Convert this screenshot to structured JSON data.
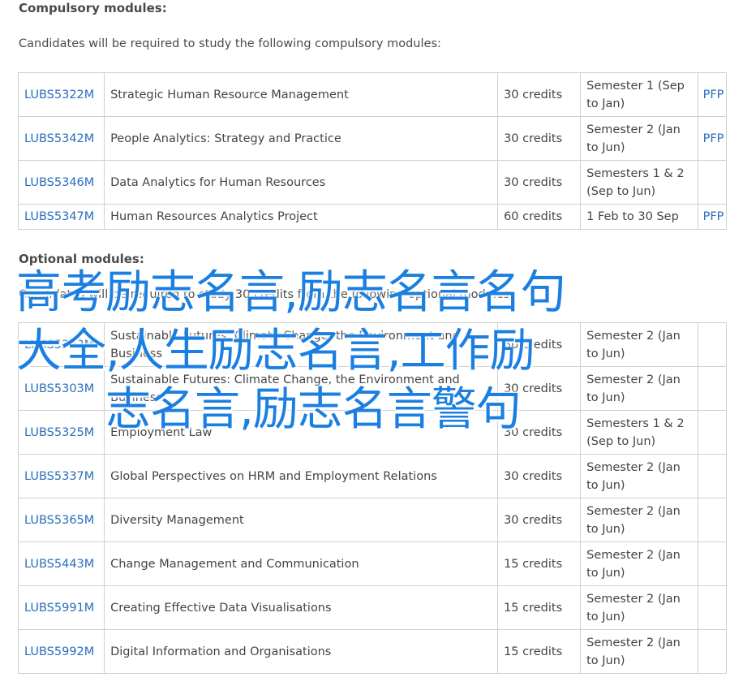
{
  "compulsory": {
    "heading": "Compulsory modules:",
    "intro": "Candidates will be required to study the following compulsory modules:",
    "rows": [
      {
        "code": "LUBS5322M",
        "title": "Strategic Human Resource Management",
        "credits": "30 credits",
        "semester": "Semester 1 (Sep to Jan)",
        "pfp": "PFP"
      },
      {
        "code": "LUBS5342M",
        "title": "People Analytics: Strategy and Practice",
        "credits": "30 credits",
        "semester": "Semester 2 (Jan to Jun)",
        "pfp": "PFP"
      },
      {
        "code": "LUBS5346M",
        "title": "Data Analytics for Human Resources",
        "credits": "30 credits",
        "semester": "Semesters 1 & 2 (Sep to Jun)",
        "pfp": ""
      },
      {
        "code": "LUBS5347M",
        "title": "Human Resources Analytics Project",
        "credits": "60 credits",
        "semester": "1 Feb to 30 Sep",
        "pfp": "PFP"
      }
    ]
  },
  "optional": {
    "heading": "Optional modules:",
    "intro": "Candidates will be required to study 30 credits from the following optional modules:",
    "rows": [
      {
        "code": "LUBS5302M",
        "title": "Sustainable Futures: Climate Change, the Environment and Business",
        "credits": "30 credits",
        "semester": "Semester 2 (Jan to Jun)",
        "pfp": ""
      },
      {
        "code": "LUBS5303M",
        "title": "Sustainable Futures: Climate Change, the Environment and Business",
        "credits": "30 credits",
        "semester": "Semester 2 (Jan to Jun)",
        "pfp": ""
      },
      {
        "code": "LUBS5325M",
        "title": "Employment Law",
        "credits": "30 credits",
        "semester": "Semesters 1 & 2 (Sep to Jun)",
        "pfp": ""
      },
      {
        "code": "LUBS5337M",
        "title": "Global Perspectives on HRM and Employment Relations",
        "credits": "30 credits",
        "semester": "Semester 2 (Jan to Jun)",
        "pfp": ""
      },
      {
        "code": "LUBS5365M",
        "title": "Diversity Management",
        "credits": "30 credits",
        "semester": "Semester 2 (Jan to Jun)",
        "pfp": ""
      },
      {
        "code": "LUBS5443M",
        "title": "Change Management and Communication",
        "credits": "15 credits",
        "semester": "Semester 2 (Jan to Jun)",
        "pfp": ""
      },
      {
        "code": "LUBS5991M",
        "title": "Creating Effective Data Visualisations",
        "credits": "15 credits",
        "semester": "Semester 2 (Jan to Jun)",
        "pfp": ""
      },
      {
        "code": "LUBS5992M",
        "title": "Digital Information and Organisations",
        "credits": "15 credits",
        "semester": "Semester 2 (Jan to Jun)",
        "pfp": ""
      }
    ]
  },
  "overlay": {
    "line1": "高考励志名言,励志名言名句",
    "line2": "大全,人生励志名言,工作励",
    "line3": "志名言,励志名言警句"
  },
  "colors": {
    "link": "#2a6ebb",
    "overlay_text": "#1a7fe0",
    "border": "#d0d0d0"
  }
}
